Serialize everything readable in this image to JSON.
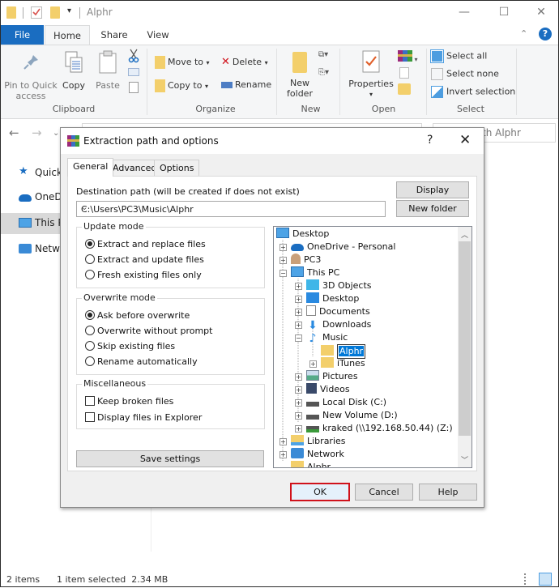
{
  "window": {
    "title": "Alphr",
    "controls": {
      "minimize": "—",
      "maximize": "☐",
      "close": "✕"
    }
  },
  "ribbon": {
    "tabs": [
      {
        "label": "File"
      },
      {
        "label": "Home"
      },
      {
        "label": "Share"
      },
      {
        "label": "View"
      }
    ],
    "clipboard": {
      "group_label": "Clipboard",
      "pin_label_1": "Pin to Quick",
      "pin_label_2": "access",
      "copy_label": "Copy",
      "paste_label": "Paste"
    },
    "organize": {
      "group_label": "Organize",
      "move_to": "Move to",
      "copy_to": "Copy to",
      "delete": "Delete",
      "rename": "Rename"
    },
    "new": {
      "group_label": "New",
      "new_folder_1": "New",
      "new_folder_2": "folder"
    },
    "open": {
      "group_label": "Open",
      "properties": "Properties"
    },
    "select": {
      "group_label": "Select",
      "select_all": "Select all",
      "select_none": "Select none",
      "invert_selection": "Invert selection"
    }
  },
  "nav": {
    "search_placeholder": "Search Alphr",
    "search_visible": "th Alphr"
  },
  "sidebar": {
    "items": [
      {
        "label": "Quick access",
        "visible": "Quick"
      },
      {
        "label": "OneDrive",
        "visible": "OneDr"
      },
      {
        "label": "This PC",
        "visible": "This P"
      },
      {
        "label": "Network",
        "visible": "Netwo"
      }
    ]
  },
  "status": {
    "items": "2 items",
    "selected": "1 item selected  2.34 MB"
  },
  "dialog": {
    "title": "Extraction path and options",
    "help": "?",
    "close": "✕",
    "tabs": [
      {
        "label": "General",
        "active": true
      },
      {
        "label": "Advanced",
        "active": false
      },
      {
        "label": "Options",
        "active": false
      }
    ],
    "destination_label": "Destination path (will be created if does not exist)",
    "destination_value": "C:\\Users\\PC3\\Music\\Alphr",
    "display_button": "Display",
    "new_folder_button": "New folder",
    "update_mode": {
      "title": "Update mode",
      "options": [
        {
          "label": "Extract and replace files",
          "checked": true
        },
        {
          "label": "Extract and update files",
          "checked": false
        },
        {
          "label": "Fresh existing files only",
          "checked": false
        }
      ]
    },
    "overwrite_mode": {
      "title": "Overwrite mode",
      "options": [
        {
          "label": "Ask before overwrite",
          "checked": true
        },
        {
          "label": "Overwrite without prompt",
          "checked": false
        },
        {
          "label": "Skip existing files",
          "checked": false
        },
        {
          "label": "Rename automatically",
          "checked": false
        }
      ]
    },
    "misc": {
      "title": "Miscellaneous",
      "options": [
        {
          "label": "Keep broken files",
          "checked": false
        },
        {
          "label": "Display files in Explorer",
          "checked": false
        }
      ]
    },
    "save_settings": "Save settings",
    "tree": [
      {
        "label": "Desktop",
        "icon": "desktop-icon"
      },
      {
        "label": "OneDrive - Personal",
        "icon": "onedrive-icon"
      },
      {
        "label": "PC3",
        "icon": "user-icon"
      },
      {
        "label": "This PC",
        "icon": "computer-icon"
      },
      {
        "label": "3D Objects",
        "icon": "3d-objects-icon"
      },
      {
        "label": "Desktop",
        "icon": "desktop-icon"
      },
      {
        "label": "Documents",
        "icon": "documents-icon"
      },
      {
        "label": "Downloads",
        "icon": "downloads-icon"
      },
      {
        "label": "Music",
        "icon": "music-icon"
      },
      {
        "label": "Alphr",
        "icon": "folder-icon",
        "editing": true
      },
      {
        "label": "iTunes",
        "icon": "folder-icon"
      },
      {
        "label": "Pictures",
        "icon": "pictures-icon"
      },
      {
        "label": "Videos",
        "icon": "videos-icon"
      },
      {
        "label": "Local Disk (C:)",
        "icon": "drive-icon"
      },
      {
        "label": "New Volume (D:)",
        "icon": "drive-icon"
      },
      {
        "label": "kraked (\\\\192.168.50.44) (Z:)",
        "icon": "network-drive-icon"
      },
      {
        "label": "Libraries",
        "icon": "libraries-icon"
      },
      {
        "label": "Network",
        "icon": "network-icon"
      },
      {
        "label": "Alphr",
        "icon": "folder-icon"
      }
    ],
    "ok": "OK",
    "cancel": "Cancel",
    "help_button": "Help",
    "highlight_color": "#d0121b"
  }
}
